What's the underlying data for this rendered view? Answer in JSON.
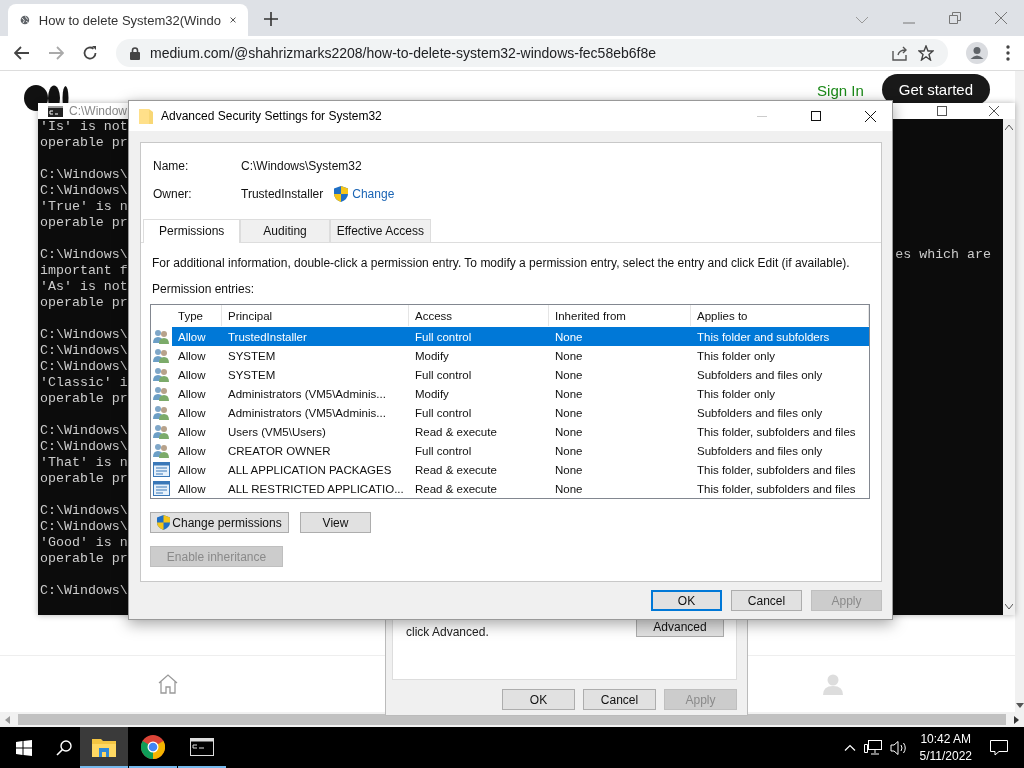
{
  "browser": {
    "tab": {
      "title": "How to delete System32(Windo"
    },
    "address": "medium.com/@shahrizmarks2208/how-to-delete-system32-windows-fec58eb6f8e"
  },
  "page": {
    "sign_in": "Sign In",
    "get_started": "Get started"
  },
  "console": {
    "title": "C:\\Window",
    "blocks": [
      [
        "'Is' is not",
        "operable pr"
      ],
      [
        "C:\\Windows\\",
        "C:\\Windows\\",
        "'True' is n",
        "operable pr"
      ],
      [
        "C:\\Windows\\",
        "important f",
        "'As' is not",
        "operable pr"
      ],
      [
        "C:\\Windows\\",
        "C:\\Windows\\",
        "C:\\Windows\\",
        "'Classic' i",
        "operable pr"
      ],
      [
        "C:\\Windows\\",
        "C:\\Windows\\",
        "'That' is n",
        "operable pr"
      ],
      [
        "C:\\Windows\\",
        "C:\\Windows\\",
        "'Good' is n",
        "operable pr"
      ],
      [
        "C:\\Windows\\"
      ]
    ],
    "right_text": "es which are"
  },
  "properties": {
    "note_2": "click Advanced.",
    "advanced": "Advanced",
    "footer": [
      {
        "label": "OK",
        "disabled": false
      },
      {
        "label": "Cancel",
        "disabled": false
      },
      {
        "label": "Apply",
        "disabled": true
      }
    ]
  },
  "dialog": {
    "title": "Advanced Security Settings for System32",
    "name_label": "Name:",
    "name_value": "C:\\Windows\\System32",
    "owner_label": "Owner:",
    "owner_value": "TrustedInstaller",
    "change_link": "Change",
    "tabs": [
      {
        "label": "Permissions",
        "selected": true
      },
      {
        "label": "Auditing",
        "selected": false
      },
      {
        "label": "Effective Access",
        "selected": false
      }
    ],
    "info": "For additional information, double-click a permission entry. To modify a permission entry, select the entry and click Edit (if available).",
    "entries_label": "Permission entries:",
    "columns": [
      "Type",
      "Principal",
      "Access",
      "Inherited from",
      "Applies to"
    ],
    "rows": [
      {
        "kind": "group",
        "selected": true,
        "type": "Allow",
        "principal": "TrustedInstaller",
        "access": "Full control",
        "inherited": "None",
        "applies": "This folder and subfolders"
      },
      {
        "kind": "group",
        "selected": false,
        "type": "Allow",
        "principal": "SYSTEM",
        "access": "Modify",
        "inherited": "None",
        "applies": "This folder only"
      },
      {
        "kind": "group",
        "selected": false,
        "type": "Allow",
        "principal": "SYSTEM",
        "access": "Full control",
        "inherited": "None",
        "applies": "Subfolders and files only"
      },
      {
        "kind": "group",
        "selected": false,
        "type": "Allow",
        "principal": "Administrators (VM5\\Adminis...",
        "access": "Modify",
        "inherited": "None",
        "applies": "This folder only"
      },
      {
        "kind": "group",
        "selected": false,
        "type": "Allow",
        "principal": "Administrators (VM5\\Adminis...",
        "access": "Full control",
        "inherited": "None",
        "applies": "Subfolders and files only"
      },
      {
        "kind": "group",
        "selected": false,
        "type": "Allow",
        "principal": "Users (VM5\\Users)",
        "access": "Read & execute",
        "inherited": "None",
        "applies": "This folder, subfolders and files"
      },
      {
        "kind": "group",
        "selected": false,
        "type": "Allow",
        "principal": "CREATOR OWNER",
        "access": "Full control",
        "inherited": "None",
        "applies": "Subfolders and files only"
      },
      {
        "kind": "package",
        "selected": false,
        "type": "Allow",
        "principal": "ALL APPLICATION PACKAGES",
        "access": "Read & execute",
        "inherited": "None",
        "applies": "This folder, subfolders and files"
      },
      {
        "kind": "package",
        "selected": false,
        "type": "Allow",
        "principal": "ALL RESTRICTED APPLICATIO...",
        "access": "Read & execute",
        "inherited": "None",
        "applies": "This folder, subfolders and files"
      }
    ],
    "change_permissions": "Change permissions",
    "view": "View",
    "enable_inheritance": {
      "label": "Enable inheritance",
      "disabled": true
    },
    "footer": [
      {
        "label": "OK",
        "focused": true,
        "disabled": false
      },
      {
        "label": "Cancel",
        "focused": false,
        "disabled": false
      },
      {
        "label": "Apply",
        "focused": false,
        "disabled": true
      }
    ]
  },
  "taskbar": {
    "apps": [
      {
        "kind": "explorer",
        "selected": true
      },
      {
        "kind": "chrome",
        "selected": false
      },
      {
        "kind": "console",
        "selected": false
      }
    ],
    "time": "10:42 AM",
    "date": "5/11/2022"
  }
}
